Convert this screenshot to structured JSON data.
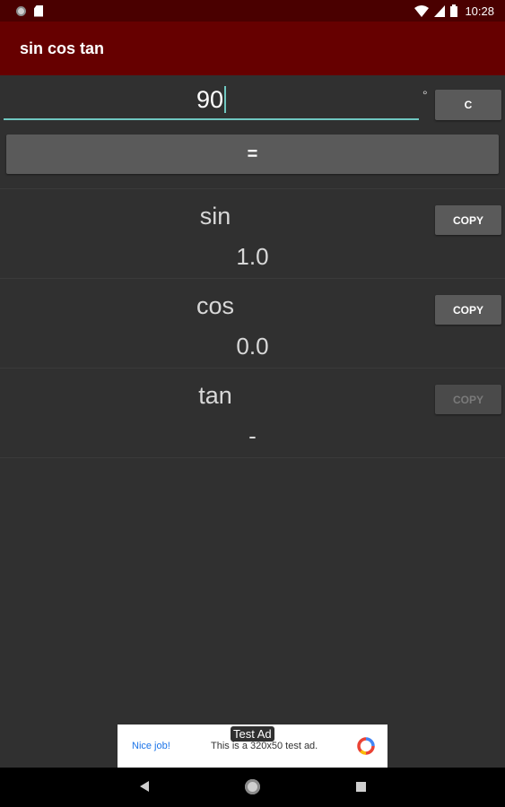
{
  "status_bar": {
    "time": "10:28",
    "icons": [
      "notification-dot-icon",
      "sd-card-icon",
      "wifi-icon",
      "signal-icon",
      "battery-icon"
    ]
  },
  "app_bar": {
    "title": "sin cos tan"
  },
  "input": {
    "value": "90",
    "unit": "°",
    "clear_label": "C"
  },
  "equals_label": "=",
  "results": [
    {
      "name": "sin",
      "value": "1.0",
      "copy_label": "COPY",
      "copy_enabled": true
    },
    {
      "name": "cos",
      "value": "0.0",
      "copy_label": "COPY",
      "copy_enabled": true
    },
    {
      "name": "tan",
      "value": "-",
      "copy_label": "COPY",
      "copy_enabled": false
    }
  ],
  "ad": {
    "tag": "Test Ad",
    "headline": "Nice job!",
    "text": "This is a 320x50 test ad."
  },
  "colors": {
    "app_bar": "#660000",
    "status_bar": "#4a0000",
    "accent": "#6fc7c0",
    "background": "#303030",
    "button": "#5a5a5a"
  }
}
